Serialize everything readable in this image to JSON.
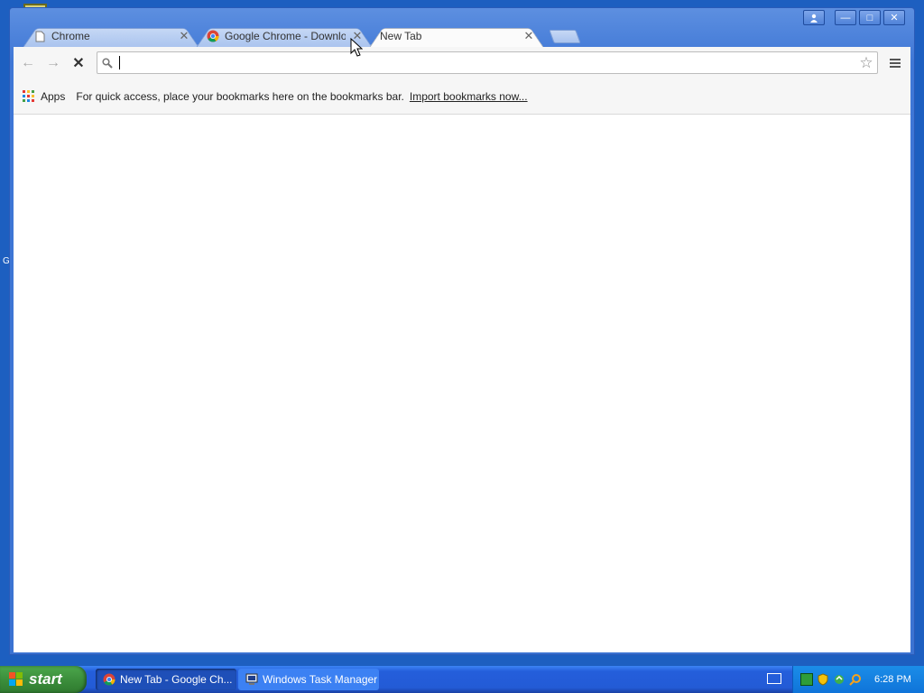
{
  "window": {
    "controls": {
      "user": "user-icon",
      "minimize": "—",
      "maximize": "□",
      "close": "✕"
    }
  },
  "tabs": [
    {
      "title": "Chrome",
      "icon": "page-icon",
      "active": false
    },
    {
      "title": "Google Chrome - Download F",
      "icon": "chrome-icon",
      "active": false
    },
    {
      "title": "New Tab",
      "icon": "",
      "active": true
    }
  ],
  "tab_close_glyph": "✕",
  "toolbar": {
    "back_glyph": "←",
    "forward_glyph": "→",
    "stop_glyph": "✕",
    "omnibox_value": "",
    "star_glyph": "☆"
  },
  "bookmarks": {
    "apps_label": "Apps",
    "hint": "For quick access, place your bookmarks here on the bookmarks bar.",
    "import_link": "Import bookmarks now..."
  },
  "desktop": {
    "side_letter": "G"
  },
  "taskbar": {
    "start_label": "start",
    "tasks": [
      {
        "label": "New Tab - Google Ch...",
        "icon": "chrome-icon",
        "active": true
      },
      {
        "label": "Windows Task Manager",
        "icon": "task-manager-icon",
        "active": false
      }
    ],
    "clock": "6:28 PM"
  },
  "colors": {
    "xp_blue": "#245edb",
    "start_green": "#3c8f3c",
    "chrome_tab_blue": "#a9c3ee"
  }
}
